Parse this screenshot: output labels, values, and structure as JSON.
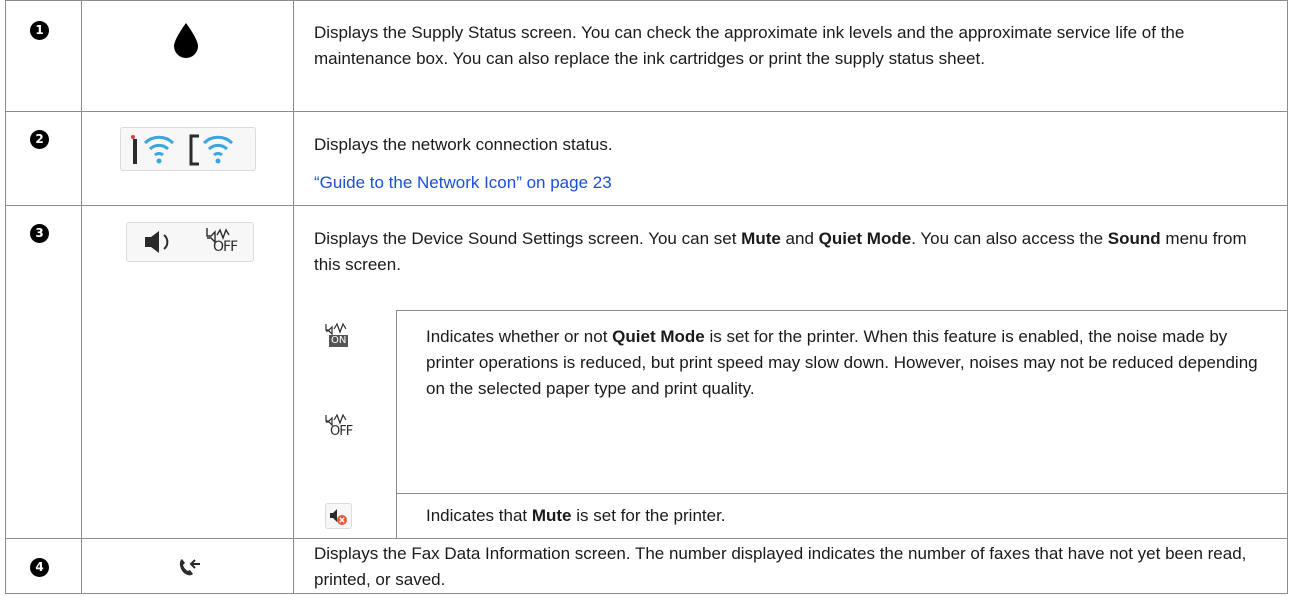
{
  "rows": [
    {
      "number": "1",
      "icon": "ink-drop-icon",
      "text": "Displays the Supply Status screen. You can check the approximate ink levels and the approximate service life of the maintenance box. You can also replace the ink cartridges or print the supply status sheet."
    },
    {
      "number": "2",
      "icon": "network-status-icon",
      "text": "Displays the network connection status.",
      "link": "“Guide to the Network Icon” on page 23"
    },
    {
      "number": "3",
      "icon": "sound-settings-icon",
      "text_parts": [
        "Displays the Device Sound Settings screen. You can set ",
        "Mute",
        " and ",
        "Quiet Mode",
        ". You can also access the ",
        "Sound",
        " menu from this screen."
      ],
      "sub": [
        {
          "icon": "quiet-mode-icon",
          "icon_labels": [
            "ON",
            "OFF"
          ],
          "text_parts": [
            "Indicates whether or not ",
            "Quiet Mode",
            " is set for the printer. When this feature is enabled, the noise made by printer operations is reduced, but print speed may slow down. However, noises may not be reduced depending on the selected paper type and print quality."
          ]
        },
        {
          "icon": "mute-icon",
          "text_parts": [
            "Indicates that ",
            "Mute",
            " is set for the printer."
          ]
        }
      ],
      "icon_label": "OFF"
    },
    {
      "number": "4",
      "icon": "fax-data-icon",
      "text": "Displays the Fax Data Information screen. The number displayed indicates the number of faxes that have not yet been read, printed, or saved."
    }
  ],
  "colors": {
    "link": "#1a4fd6",
    "wifi": "#3aa6dd",
    "border": "#8c8c8c",
    "mute_badge": "#e8553a"
  }
}
